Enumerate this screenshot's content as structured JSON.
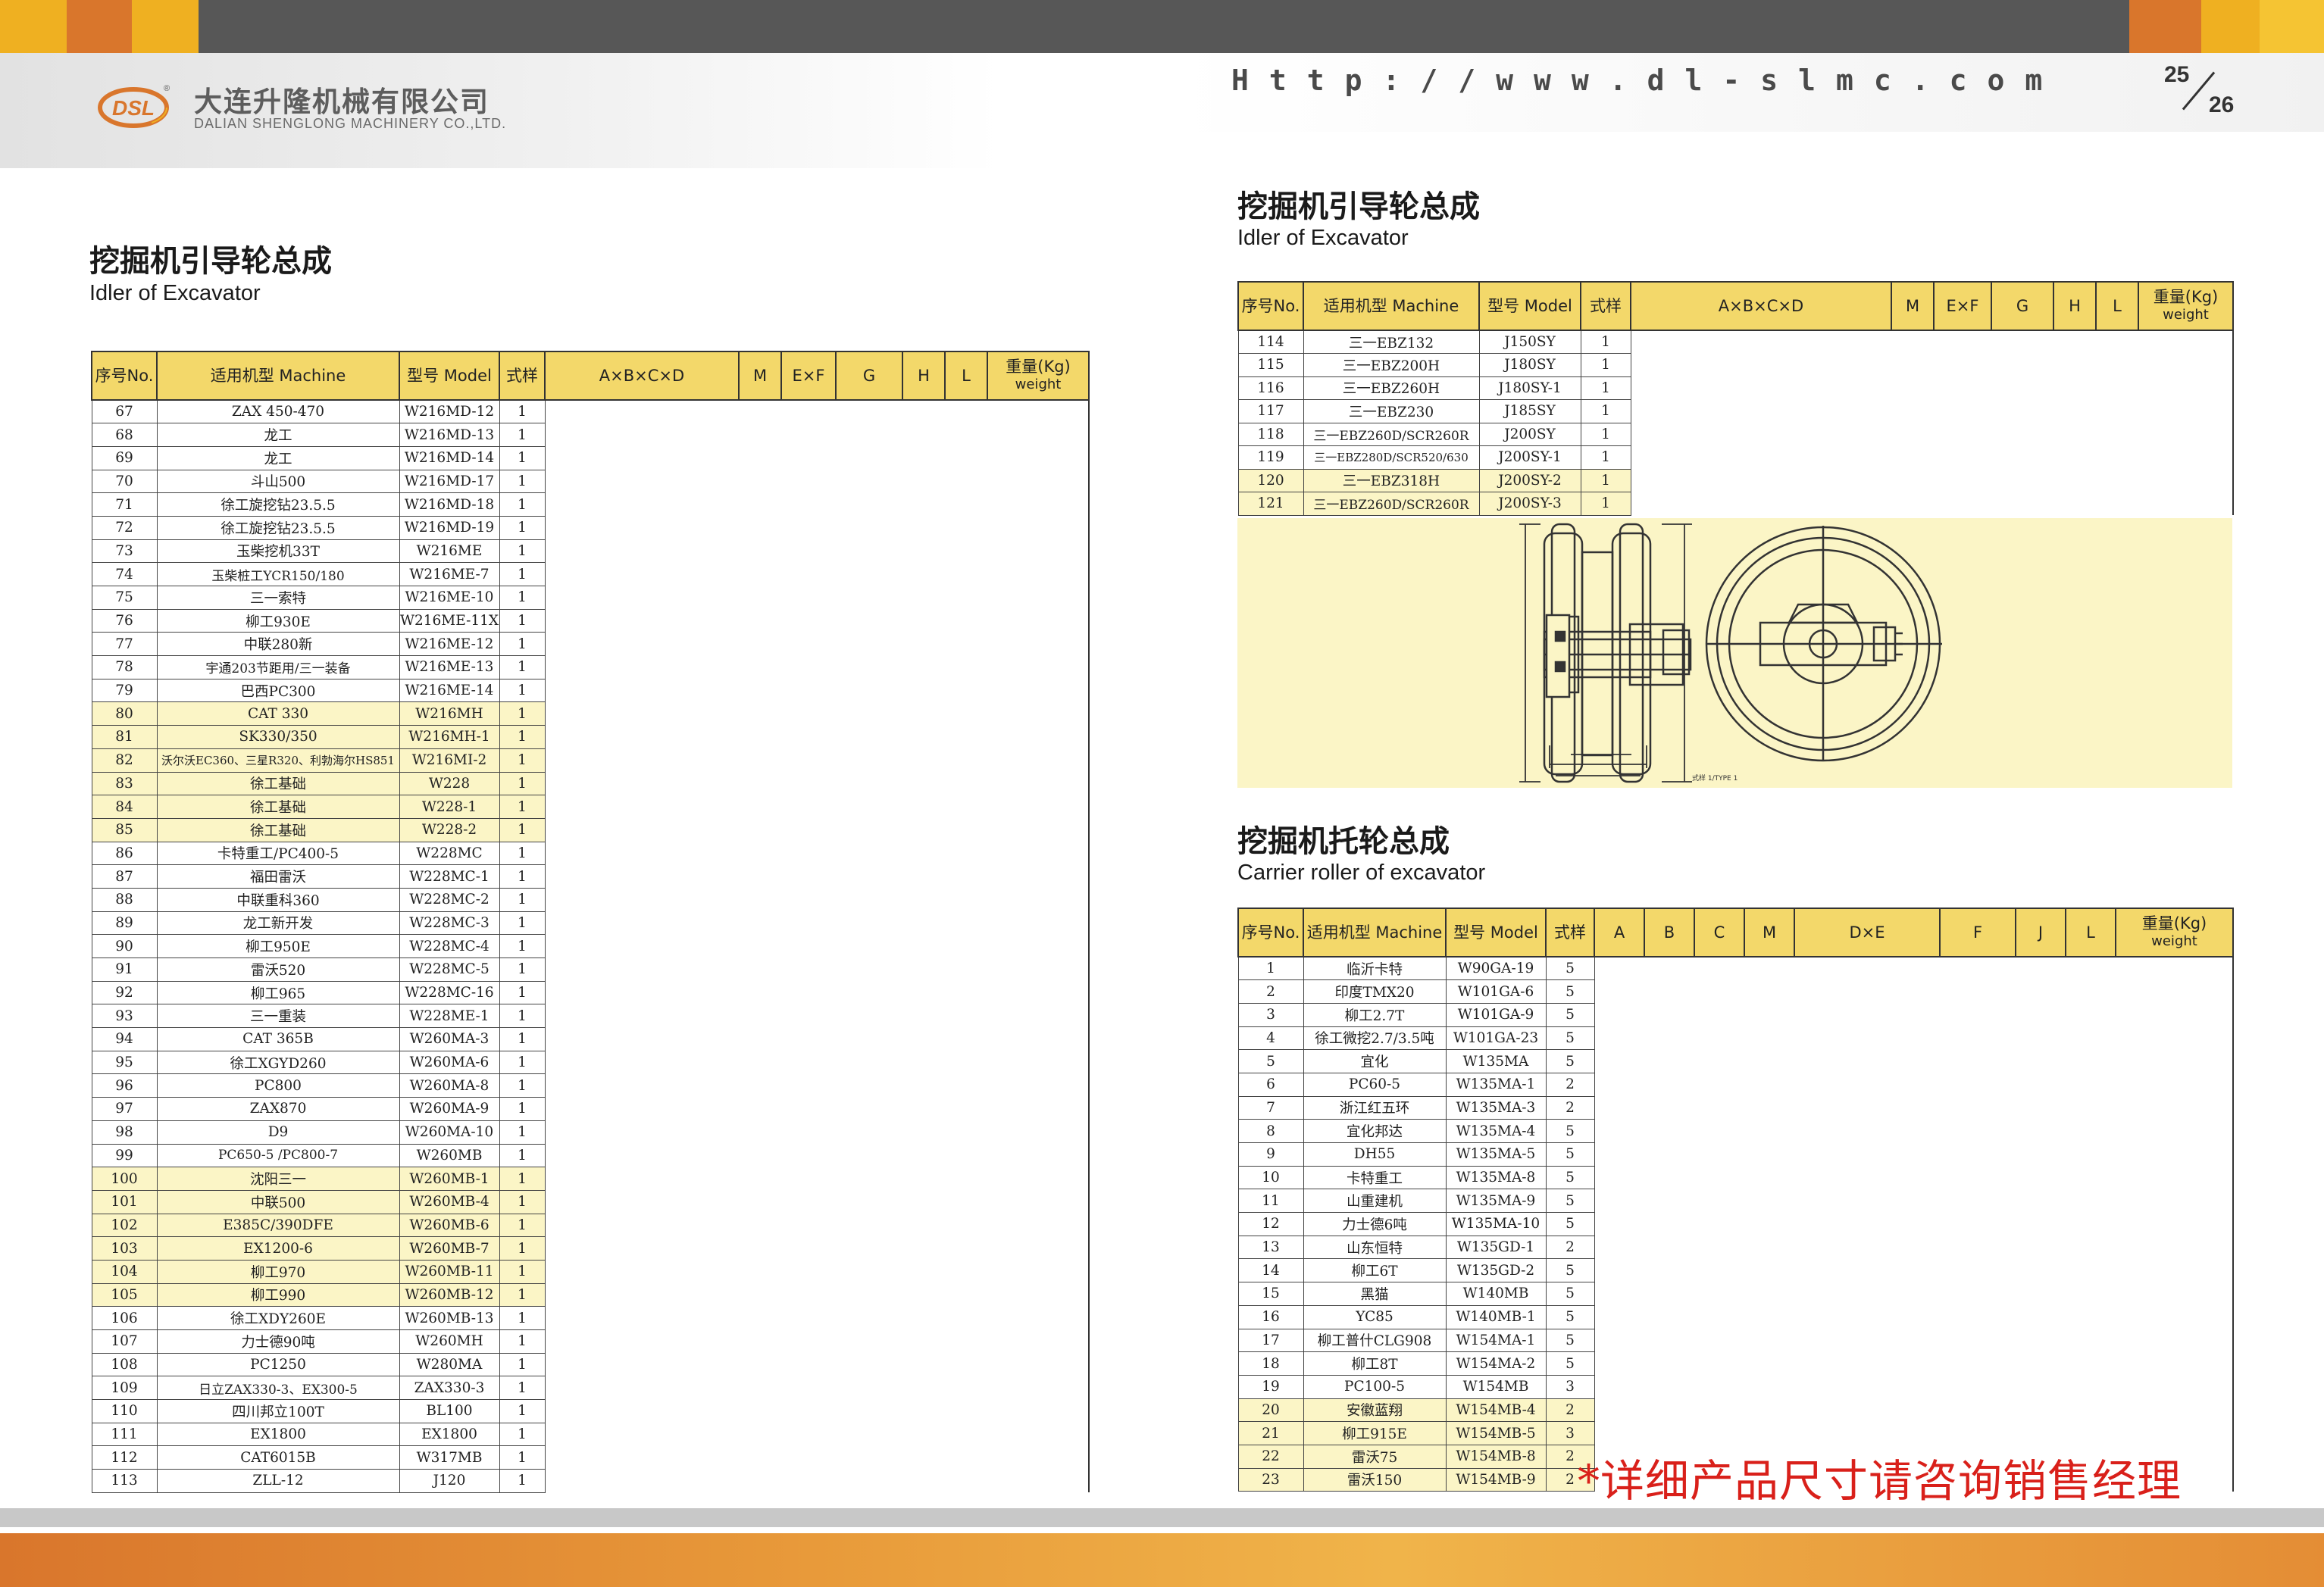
{
  "header": {
    "company_cn": "大连升隆机械有限公司",
    "company_en": "DALIAN SHENGLONG MACHINERY CO.,LTD.",
    "logo_text": "DSL",
    "url": "Http://www.dl-slmc.com",
    "page_left": "25",
    "page_right": "26"
  },
  "left": {
    "title_cn": "挖掘机引导轮总成",
    "title_en": "Idler of Excavator",
    "columns": {
      "no": "序号No.",
      "machine": "适用机型  Machine",
      "model": "型号  Model",
      "type": "式样",
      "abcd": "A×B×C×D",
      "m": "M",
      "ef": "E×F",
      "g": "G",
      "h": "H",
      "l": "L",
      "weight_cn": "重量(Kg)",
      "weight_en": "weight"
    },
    "rows": [
      [
        "67",
        "ZAX 450-470",
        "W216MD-12",
        "1"
      ],
      [
        "68",
        "龙工",
        "W216MD-13",
        "1"
      ],
      [
        "69",
        "龙工",
        "W216MD-14",
        "1"
      ],
      [
        "70",
        "斗山500",
        "W216MD-17",
        "1"
      ],
      [
        "71",
        "徐工旋挖钻23.5.5",
        "W216MD-18",
        "1"
      ],
      [
        "72",
        "徐工旋挖钻23.5.5",
        "W216MD-19",
        "1"
      ],
      [
        "73",
        "玉柴挖机33T",
        "W216ME",
        "1"
      ],
      [
        "74",
        "玉柴桩工YCR150/180",
        "W216ME-7",
        "1"
      ],
      [
        "75",
        "三一索特",
        "W216ME-10",
        "1"
      ],
      [
        "76",
        "柳工930E",
        "W216ME-11X",
        "1"
      ],
      [
        "77",
        "中联280新",
        "W216ME-12",
        "1"
      ],
      [
        "78",
        "宇通203节距用/三一装备",
        "W216ME-13",
        "1"
      ],
      [
        "79",
        "巴西PC300",
        "W216ME-14",
        "1"
      ],
      [
        "80",
        "CAT 330",
        "W216MH",
        "1"
      ],
      [
        "81",
        "SK330/350",
        "W216MH-1",
        "1"
      ],
      [
        "82",
        "沃尔沃EC360、三星R320、利勃海尔HS851",
        "W216MI-2",
        "1"
      ],
      [
        "83",
        "徐工基础",
        "W228",
        "1"
      ],
      [
        "84",
        "徐工基础",
        "W228-1",
        "1"
      ],
      [
        "85",
        "徐工基础",
        "W228-2",
        "1"
      ],
      [
        "86",
        "卡特重工/PC400-5",
        "W228MC",
        "1"
      ],
      [
        "87",
        "福田雷沃",
        "W228MC-1",
        "1"
      ],
      [
        "88",
        "中联重科360",
        "W228MC-2",
        "1"
      ],
      [
        "89",
        "龙工新开发",
        "W228MC-3",
        "1"
      ],
      [
        "90",
        "柳工950E",
        "W228MC-4",
        "1"
      ],
      [
        "91",
        "雷沃520",
        "W228MC-5",
        "1"
      ],
      [
        "92",
        "柳工965",
        "W228MC-16",
        "1"
      ],
      [
        "93",
        "三一重装",
        "W228ME-1",
        "1"
      ],
      [
        "94",
        "CAT 365B",
        "W260MA-3",
        "1"
      ],
      [
        "95",
        "徐工XGYD260",
        "W260MA-6",
        "1"
      ],
      [
        "96",
        "PC800",
        "W260MA-8",
        "1"
      ],
      [
        "97",
        "ZAX870",
        "W260MA-9",
        "1"
      ],
      [
        "98",
        "D9",
        "W260MA-10",
        "1"
      ],
      [
        "99",
        "PC650-5 /PC800-7",
        "W260MB",
        "1"
      ],
      [
        "100",
        "沈阳三一",
        "W260MB-1",
        "1"
      ],
      [
        "101",
        "中联500",
        "W260MB-4",
        "1"
      ],
      [
        "102",
        "E385C/390DFE",
        "W260MB-6",
        "1"
      ],
      [
        "103",
        "EX1200-6",
        "W260MB-7",
        "1"
      ],
      [
        "104",
        "柳工970",
        "W260MB-11",
        "1"
      ],
      [
        "105",
        "柳工990",
        "W260MB-12",
        "1"
      ],
      [
        "106",
        "徐工XDY260E",
        "W260MB-13",
        "1"
      ],
      [
        "107",
        "力士德90吨",
        "W260MH",
        "1"
      ],
      [
        "108",
        "PC1250",
        "W280MA",
        "1"
      ],
      [
        "109",
        "日立ZAX330-3、EX300-5",
        "ZAX330-3",
        "1"
      ],
      [
        "110",
        "四川邦立100T",
        "BL100",
        "1"
      ],
      [
        "111",
        "EX1800",
        "EX1800",
        "1"
      ],
      [
        "112",
        "CAT6015B",
        "W317MB",
        "1"
      ],
      [
        "113",
        "ZLL-12",
        "J120",
        "1"
      ]
    ],
    "highlight_rows": [
      "80",
      "81",
      "82",
      "83",
      "84",
      "85",
      "100",
      "101",
      "102",
      "103",
      "104",
      "105"
    ]
  },
  "right_idler": {
    "title_cn": "挖掘机引导轮总成",
    "title_en": "Idler of Excavator",
    "columns": {
      "no": "序号No.",
      "machine": "适用机型  Machine",
      "model": "型号  Model",
      "type": "式样",
      "abcd": "A×B×C×D",
      "m": "M",
      "ef": "E×F",
      "g": "G",
      "h": "H",
      "l": "L",
      "weight_cn": "重量(Kg)",
      "weight_en": "weight"
    },
    "rows": [
      [
        "114",
        "三一EBZ132",
        "J150SY",
        "1"
      ],
      [
        "115",
        "三一EBZ200H",
        "J180SY",
        "1"
      ],
      [
        "116",
        "三一EBZ260H",
        "J180SY-1",
        "1"
      ],
      [
        "117",
        "三一EBZ230",
        "J185SY",
        "1"
      ],
      [
        "118",
        "三一EBZ260D/SCR260R",
        "J200SY",
        "1"
      ],
      [
        "119",
        "三一EBZ280D/SCR520/630",
        "J200SY-1",
        "1"
      ],
      [
        "120",
        "三一EBZ318H",
        "J200SY-2",
        "1"
      ],
      [
        "121",
        "三一EBZ260D/SCR260R",
        "J200SY-3",
        "1"
      ]
    ],
    "highlight_rows": [
      "120",
      "121"
    ],
    "diagram_caption": "式样 1/TYPE 1"
  },
  "carrier": {
    "title_cn": "挖掘机托轮总成",
    "title_en": "Carrier roller of excavator",
    "columns": {
      "no": "序号No.",
      "machine": "适用机型  Machine",
      "model": "型号  Model",
      "type": "式样",
      "a": "A",
      "b": "B",
      "c": "C",
      "m": "M",
      "de": "D×E",
      "f": "F",
      "j": "J",
      "l": "L",
      "weight_cn": "重量(Kg)",
      "weight_en": "weight"
    },
    "rows": [
      [
        "1",
        "临沂卡特",
        "W90GA-19",
        "5"
      ],
      [
        "2",
        "印度TMX20",
        "W101GA-6",
        "5"
      ],
      [
        "3",
        "柳工2.7T",
        "W101GA-9",
        "5"
      ],
      [
        "4",
        "徐工微挖2.7/3.5吨",
        "W101GA-23",
        "5"
      ],
      [
        "5",
        "宜化",
        "W135MA",
        "5"
      ],
      [
        "6",
        "PC60-5",
        "W135MA-1",
        "2"
      ],
      [
        "7",
        "浙江红五环",
        "W135MA-3",
        "2"
      ],
      [
        "8",
        "宜化邦达",
        "W135MA-4",
        "5"
      ],
      [
        "9",
        "DH55",
        "W135MA-5",
        "5"
      ],
      [
        "10",
        "卡特重工",
        "W135MA-8",
        "5"
      ],
      [
        "11",
        "山重建机",
        "W135MA-9",
        "5"
      ],
      [
        "12",
        "力士德6吨",
        "W135MA-10",
        "5"
      ],
      [
        "13",
        "山东恒特",
        "W135GD-1",
        "2"
      ],
      [
        "14",
        "柳工6T",
        "W135GD-2",
        "5"
      ],
      [
        "15",
        "黑猫",
        "W140MB",
        "5"
      ],
      [
        "16",
        "YC85",
        "W140MB-1",
        "5"
      ],
      [
        "17",
        "柳工普什CLG908",
        "W154MA-1",
        "5"
      ],
      [
        "18",
        "柳工8T",
        "W154MA-2",
        "5"
      ],
      [
        "19",
        "PC100-5",
        "W154MB",
        "3"
      ],
      [
        "20",
        "安徽蓝翔",
        "W154MB-4",
        "2"
      ],
      [
        "21",
        "柳工915E",
        "W154MB-5",
        "3"
      ],
      [
        "22",
        "雷沃75",
        "W154MB-8",
        "2"
      ],
      [
        "23",
        "雷沃150",
        "W154MB-9",
        "2"
      ]
    ],
    "highlight_rows": [
      "20",
      "21",
      "22",
      "23"
    ]
  },
  "notice": "*详细产品尺寸请咨询销售经理",
  "colors": {
    "header_fill": "#f3d86a",
    "highlight_fill": "#fbf5c6",
    "accent_orange": "#d9762c",
    "accent_yellow": "#efb021",
    "notice_red": "#d9201a"
  }
}
